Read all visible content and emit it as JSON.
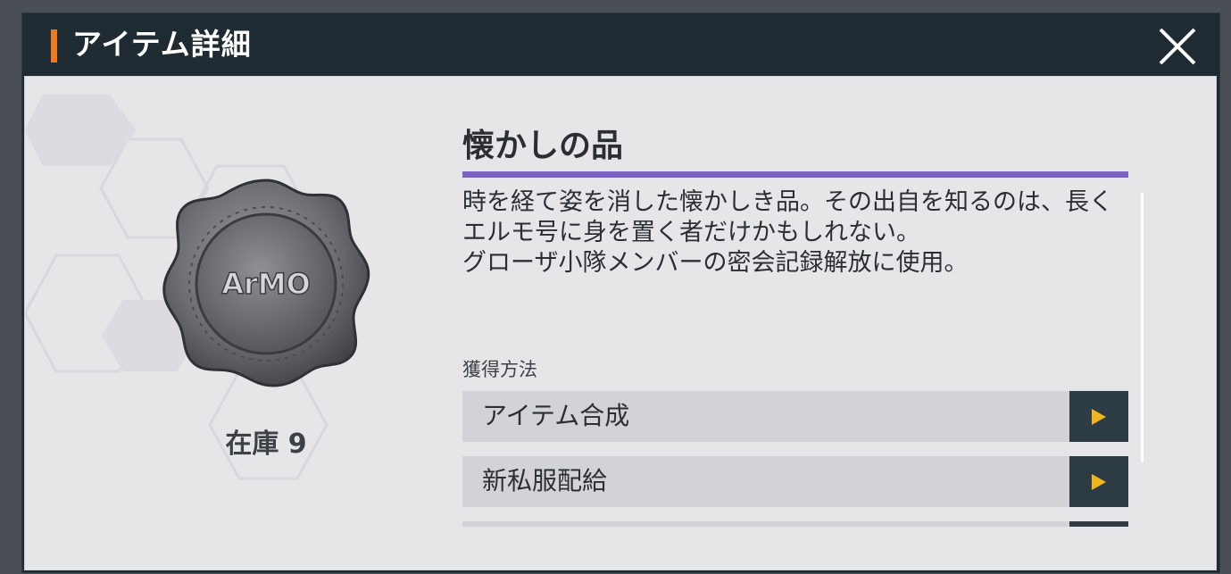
{
  "dialog": {
    "title": "アイテム詳細",
    "close_icon": "close-x-icon",
    "accent_color": "#f07a22"
  },
  "item": {
    "name": "懐かしの品",
    "stock": "在庫 9",
    "emblem_text": "ArMO",
    "divider_color": "#7b62c4",
    "description": [
      "時を経て姿を消した懐かしき品。その出自を知るのは、長くエルモ号に身を置く者だけかもしれない。",
      "グローザ小隊メンバーの密会記録解放に使用。"
    ]
  },
  "acquisition": {
    "label": "獲得方法",
    "methods": [
      {
        "label": "アイテム合成",
        "icon": "play-arrow-icon"
      },
      {
        "label": "新私服配給",
        "icon": "play-arrow-icon"
      }
    ]
  }
}
